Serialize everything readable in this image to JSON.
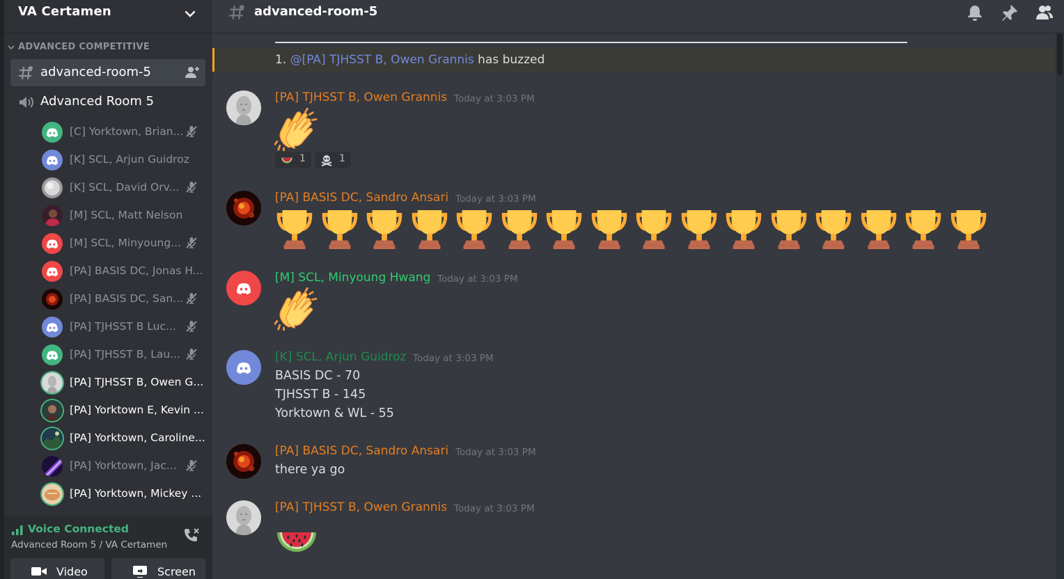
{
  "server": {
    "name": "VA Certamen"
  },
  "sidebar": {
    "category": "ADVANCED COMPETITIVE",
    "text_channel": "advanced-room-5",
    "voice_channel": "Advanced Room 5",
    "voice_users": [
      {
        "name": "[C] Yorktown, Brian...",
        "active": false,
        "muted": true,
        "avatar": "discord-green"
      },
      {
        "name": "[K] SCL, Arjun Guidroz",
        "active": false,
        "muted": false,
        "avatar": "discord-blurple"
      },
      {
        "name": "[K] SCL, David Orv...",
        "active": false,
        "muted": true,
        "avatar": "photo-grey"
      },
      {
        "name": "[M] SCL, Matt Nelson",
        "active": false,
        "muted": false,
        "avatar": "photo-person"
      },
      {
        "name": "[M] SCL, Minyoung...",
        "active": false,
        "muted": true,
        "avatar": "discord-red"
      },
      {
        "name": "[PA] BASIS DC, Jonas H...",
        "active": false,
        "muted": false,
        "avatar": "discord-red"
      },
      {
        "name": "[PA] BASIS DC, San...",
        "active": false,
        "muted": true,
        "avatar": "photo-fire"
      },
      {
        "name": "[PA] TJHSST B Luc...",
        "active": false,
        "muted": true,
        "avatar": "discord-blurple"
      },
      {
        "name": "[PA] TJHSST B, Lau...",
        "active": false,
        "muted": true,
        "avatar": "discord-green"
      },
      {
        "name": "[PA] TJHSST B, Owen G...",
        "active": true,
        "muted": false,
        "avatar": "photo-statue"
      },
      {
        "name": "[PA] Yorktown E, Kevin ...",
        "active": true,
        "muted": false,
        "avatar": "photo-portrait"
      },
      {
        "name": "[PA] Yorktown, Caroline...",
        "active": true,
        "muted": false,
        "avatar": "photo-landscape"
      },
      {
        "name": "[PA] Yorktown, Jac...",
        "active": false,
        "muted": true,
        "avatar": "photo-purple"
      },
      {
        "name": "[PA] Yorktown, Mickey ...",
        "active": true,
        "muted": false,
        "avatar": "photo-bread"
      }
    ]
  },
  "voice_panel": {
    "status": "Voice Connected",
    "location": "Advanced Room 5 / VA Certamen",
    "video_label": "Video",
    "screen_label": "Screen"
  },
  "channel": {
    "title": "advanced-room-5"
  },
  "buzz": {
    "prefix": "1. ",
    "mention": "@[PA] TJHSST B, Owen Grannis",
    "suffix": " has buzzed"
  },
  "messages": [
    {
      "author": "[PA] TJHSST B, Owen Grannis",
      "time": "Today at 3:03 PM",
      "content": "clapping-hands-emoji",
      "reactions": [
        {
          "emoji": "watermelon-emoji",
          "count": "1"
        },
        {
          "emoji": "skull-crossbones-emoji",
          "count": "1"
        }
      ]
    },
    {
      "author": "[PA] BASIS DC, Sandro Ansari",
      "time": "Today at 3:03 PM",
      "content": "trophy-emoji",
      "trophy_count": 16
    },
    {
      "author": "[M] SCL, Minyoung Hwang",
      "time": "Today at 3:03 PM",
      "content": "clapping-hands-emoji"
    },
    {
      "author": "[K] SCL, Arjun Guidroz",
      "time": "Today at 3:03 PM",
      "lines": [
        "BASIS DC - 70",
        "TJHSST B - 145",
        "Yorktown & WL - 55"
      ]
    },
    {
      "author": "[PA] BASIS DC, Sandro Ansari",
      "time": "Today at 3:03 PM",
      "lines": [
        "there ya go"
      ]
    },
    {
      "author": "[PA] TJHSST B, Owen Grannis",
      "time": "Today at 3:03 PM",
      "content": "watermelon-emoji"
    }
  ],
  "colors": {
    "accent_orange": "#e67e22",
    "accent_green": "#2ecc71",
    "accent_teal": "#1f8b4c",
    "mention": "#7289da",
    "voice_connected": "#43b581"
  }
}
